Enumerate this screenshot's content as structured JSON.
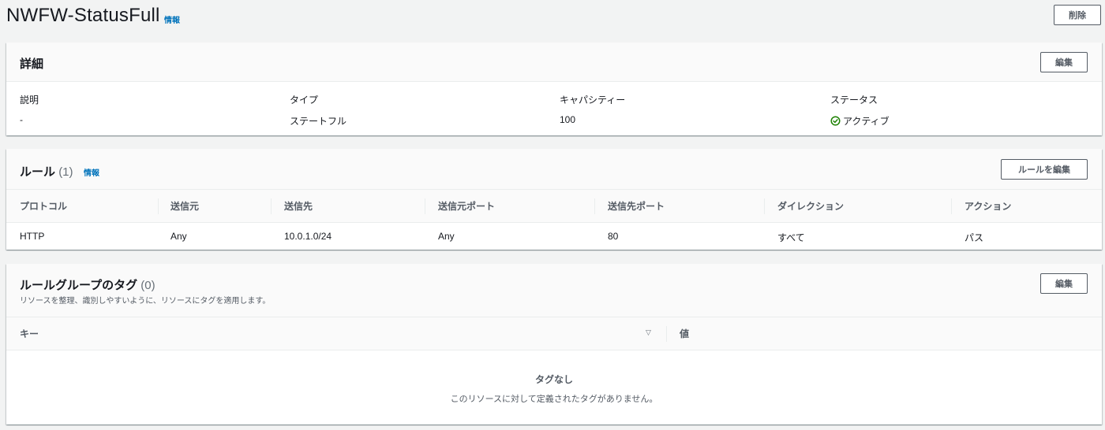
{
  "header": {
    "title": "NWFW-StatusFull",
    "info": "情報",
    "delete_label": "削除"
  },
  "details": {
    "title": "詳細",
    "edit_label": "編集",
    "fields": [
      {
        "key": "説明",
        "value": "-"
      },
      {
        "key": "タイプ",
        "value": "ステートフル"
      },
      {
        "key": "キャパシティー",
        "value": "100"
      },
      {
        "key": "ステータス",
        "value": "アクティブ"
      }
    ],
    "status_color": "#1d8102"
  },
  "rules": {
    "title": "ルール",
    "count": "(1)",
    "info": "情報",
    "edit_label": "ルールを編集",
    "columns": [
      "プロトコル",
      "送信元",
      "送信先",
      "送信元ポート",
      "送信先ポート",
      "ダイレクション",
      "アクション"
    ],
    "rows": [
      [
        "HTTP",
        "Any",
        "10.0.1.0/24",
        "Any",
        "80",
        "すべて",
        "パス"
      ]
    ]
  },
  "tags": {
    "title": "ルールグループのタグ",
    "count": "(0)",
    "description": "リソースを整理、識別しやすいように、リソースにタグを適用します。",
    "edit_label": "編集",
    "columns": [
      "キー",
      "値"
    ],
    "empty_title": "タグなし",
    "empty_description": "このリソースに対して定義されたタグがありません。"
  },
  "colors": {
    "link": "#0073bb",
    "page_bg": "#f2f3f3"
  }
}
